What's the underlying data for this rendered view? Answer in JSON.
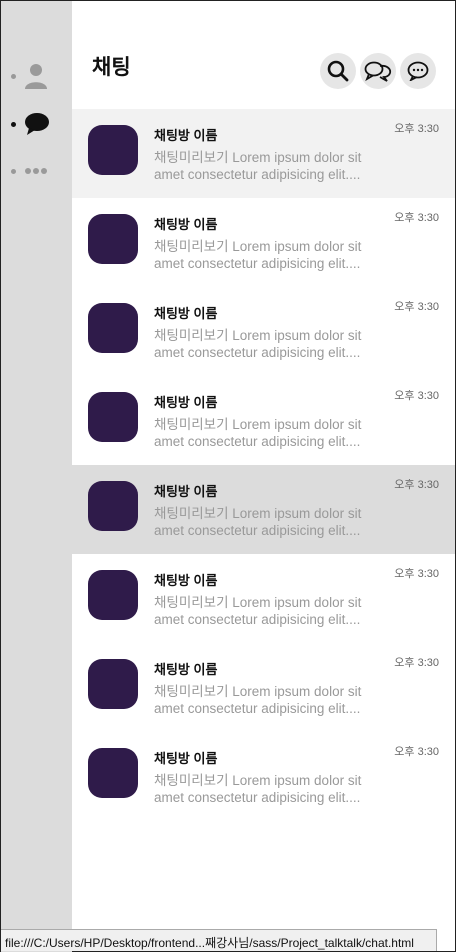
{
  "sidebar": {
    "items": [
      {
        "name": "friends",
        "icon": "person-icon",
        "active": false
      },
      {
        "name": "chats",
        "icon": "chat-bubble-icon",
        "active": true
      },
      {
        "name": "more",
        "icon": "more-dots-icon",
        "active": false
      }
    ]
  },
  "header": {
    "title": "채팅",
    "buttons": [
      {
        "icon": "search-icon"
      },
      {
        "icon": "open-chat-icon"
      },
      {
        "icon": "new-chat-icon"
      }
    ]
  },
  "chats": [
    {
      "name": "채팅방 이름",
      "preview": "채팅미리보기 Lorem ipsum dolor sit amet consectetur adipisicing elit....",
      "time": "오후 3:30"
    },
    {
      "name": "채팅방 이름",
      "preview": "채팅미리보기 Lorem ipsum dolor sit amet consectetur adipisicing elit....",
      "time": "오후 3:30"
    },
    {
      "name": "채팅방 이름",
      "preview": "채팅미리보기 Lorem ipsum dolor sit amet consectetur adipisicing elit....",
      "time": "오후 3:30"
    },
    {
      "name": "채팅방 이름",
      "preview": "채팅미리보기 Lorem ipsum dolor sit amet consectetur adipisicing elit....",
      "time": "오후 3:30"
    },
    {
      "name": "채팅방 이름",
      "preview": "채팅미리보기 Lorem ipsum dolor sit amet consectetur adipisicing elit....",
      "time": "오후 3:30"
    },
    {
      "name": "채팅방 이름",
      "preview": "채팅미리보기 Lorem ipsum dolor sit amet consectetur adipisicing elit....",
      "time": "오후 3:30"
    },
    {
      "name": "채팅방 이름",
      "preview": "채팅미리보기 Lorem ipsum dolor sit amet consectetur adipisicing elit....",
      "time": "오후 3:30"
    },
    {
      "name": "채팅방 이름",
      "preview": "채팅미리보기 Lorem ipsum dolor sit amet consectetur adipisicing elit....",
      "time": "오후 3:30"
    }
  ],
  "colors": {
    "avatar": "#2f1b4a",
    "sidebar_bg": "#dcdcdc",
    "row_hover": "#f2f2f2",
    "row_selected": "#dcdcdc"
  },
  "statusbar": {
    "url": "file:///C:/Users/HP/Desktop/frontend...째강사님/sass/Project_talktalk/chat.html"
  }
}
